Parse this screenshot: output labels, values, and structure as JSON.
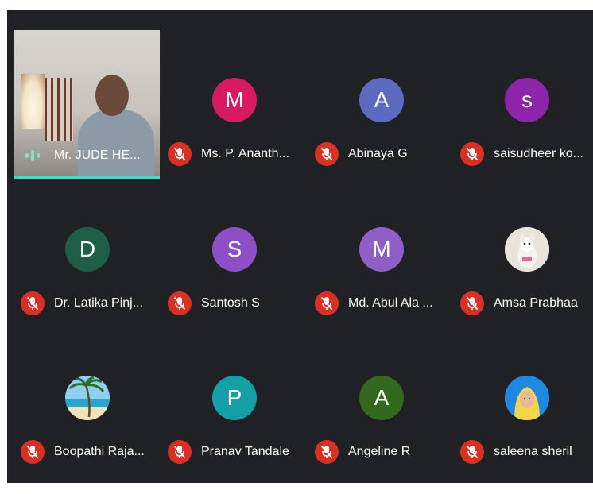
{
  "participants": [
    {
      "name": "Mr. JUDE HE...",
      "initial": "",
      "avatar_color": "",
      "muted": false,
      "video": true
    },
    {
      "name": "Ms. P. Ananth...",
      "initial": "M",
      "avatar_color": "#d81b60",
      "muted": true
    },
    {
      "name": "Abinaya G",
      "initial": "A",
      "avatar_color": "#5c6bc0",
      "muted": true
    },
    {
      "name": "saisudheer ko...",
      "initial": "s",
      "avatar_color": "#8e24aa",
      "muted": true
    },
    {
      "name": "Dr. Latika Pinj...",
      "initial": "D",
      "avatar_color": "#1e5e46",
      "muted": true
    },
    {
      "name": "Santosh S",
      "initial": "S",
      "avatar_color": "#8e4fc6",
      "muted": true
    },
    {
      "name": "Md. Abul Ala ...",
      "initial": "M",
      "avatar_color": "#8e5fc7",
      "muted": true
    },
    {
      "name": "Amsa Prabhaa",
      "initial": "",
      "avatar_color": "#e8e4dc",
      "muted": true,
      "photo": "dog"
    },
    {
      "name": "Boopathi Raja...",
      "initial": "",
      "avatar_color": "#6fb6d8",
      "muted": true,
      "photo": "beach"
    },
    {
      "name": "Pranav Tandale",
      "initial": "P",
      "avatar_color": "#159fa6",
      "muted": true
    },
    {
      "name": "Angeline R",
      "initial": "A",
      "avatar_color": "#33691e",
      "muted": true
    },
    {
      "name": "saleena sheril",
      "initial": "",
      "avatar_color": "#1e88e5",
      "muted": true,
      "photo": "woman"
    }
  ]
}
